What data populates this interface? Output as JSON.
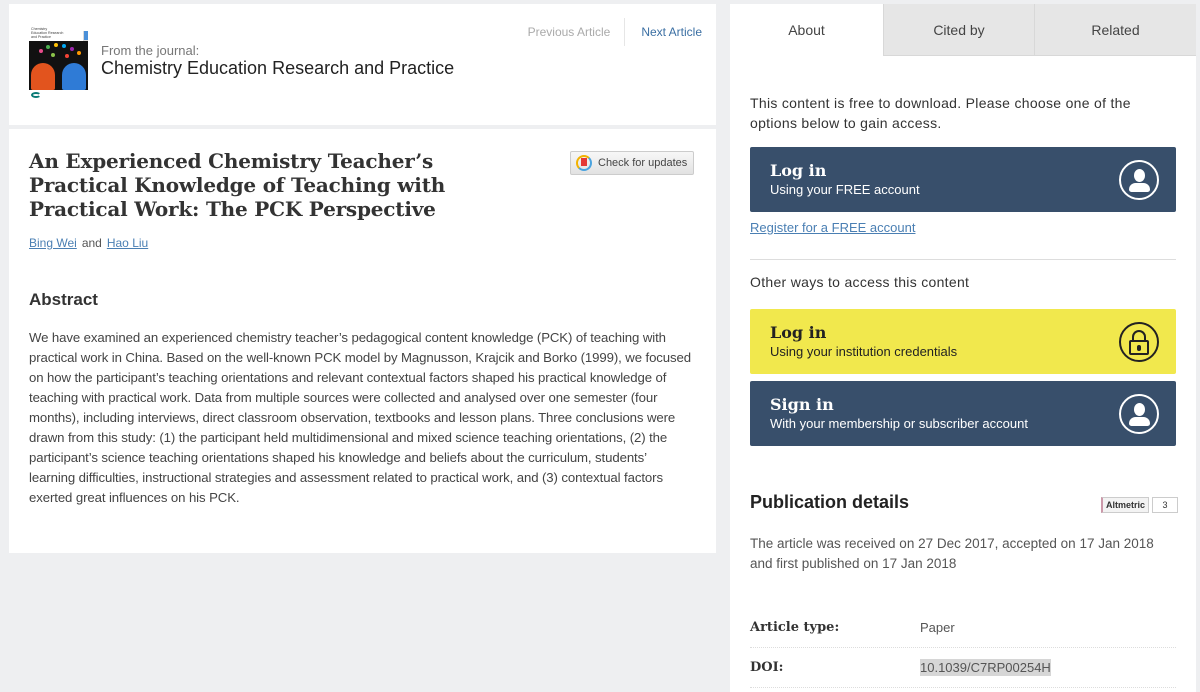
{
  "journal": {
    "cover_alt": "Chemistry Education Research and Practice",
    "from_label": "From the journal:",
    "name": "Chemistry Education Research and Practice"
  },
  "nav": {
    "previous": "Previous Article",
    "next": "Next Article"
  },
  "article": {
    "title": "An Experienced Chemistry Teacher’s Practical Knowledge of Teaching with Practical Work: The PCK Perspective",
    "check_updates_label": "Check for updates",
    "authors": [
      "Bing Wei",
      "Hao Liu"
    ],
    "authors_joiner": "and",
    "abstract_heading": "Abstract",
    "abstract": "We have examined an experienced chemistry teacher’s pedagogical content knowledge (PCK) of teaching with practical work in China. Based on the well-known PCK model by Magnusson, Krajcik and Borko (1999), we focused on how the participant’s teaching orientations and relevant contextual factors shaped his practical knowledge of teaching with practical work. Data from multiple sources were collected and analysed over one semester (four months), including interviews, direct classroom observation, textbooks and lesson plans. Three conclusions were drawn from this study: (1) the participant held multidimensional and mixed science teaching orientations, (2) the participant’s science teaching orientations shaped his knowledge and beliefs about the curriculum, students’ learning difficulties, instructional strategies and assessment related to practical work, and (3) contextual factors exerted great influences on his PCK."
  },
  "sidebar": {
    "tabs": [
      {
        "label": "About",
        "active": true
      },
      {
        "label": "Cited by",
        "active": false
      },
      {
        "label": "Related",
        "active": false
      }
    ],
    "access_intro": "This content is free to download. Please choose one of the options below to gain access.",
    "login_free": {
      "title": "Log in",
      "subtitle": "Using your FREE account",
      "icon": "user-icon"
    },
    "register_link": "Register for a FREE account",
    "other_ways": "Other ways to access this content",
    "login_institution": {
      "title": "Log in",
      "subtitle": "Using your institution credentials",
      "icon": "lock-icon"
    },
    "sign_in": {
      "title": "Sign in",
      "subtitle": "With your membership or subscriber account",
      "icon": "user-icon"
    },
    "publication": {
      "heading": "Publication details",
      "altmetric_label": "Altmetric",
      "altmetric_score": "3",
      "dates": "The article was received on 27 Dec 2017, accepted on 17 Jan 2018 and first published on 17 Jan 2018",
      "details": [
        {
          "label": "Article type:",
          "value": "Paper"
        },
        {
          "label": "DOI:",
          "value": "10.1039/C7RP00254H"
        }
      ]
    }
  },
  "colors": {
    "dark_button": "#384f6b",
    "yellow_button": "#f1e84d",
    "link": "#4a7fb3",
    "background": "#eeeff1"
  }
}
